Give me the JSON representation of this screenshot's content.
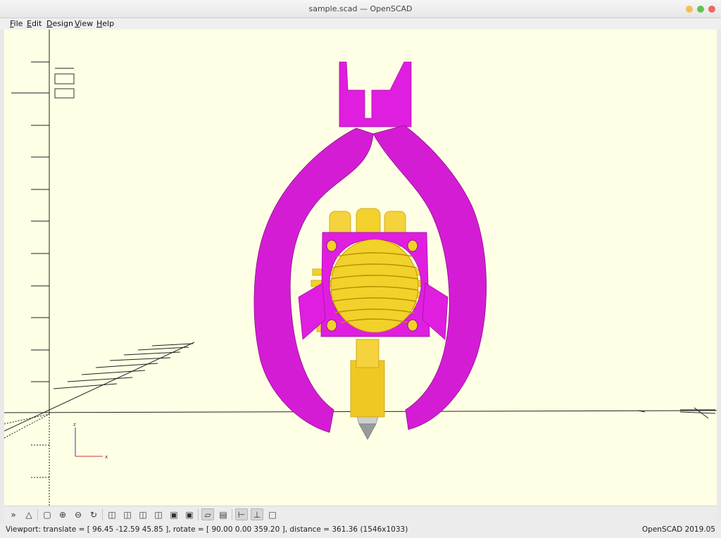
{
  "window": {
    "title": "sample.scad — OpenSCAD",
    "controls": [
      {
        "name": "minimize",
        "color": "#f5bf4f"
      },
      {
        "name": "maximize",
        "color": "#61c554"
      },
      {
        "name": "close",
        "color": "#ed6a5e"
      }
    ]
  },
  "menu": [
    {
      "label": "File",
      "mnemonic": "F",
      "rest": "ile"
    },
    {
      "label": "Edit",
      "mnemonic": "E",
      "rest": "dit"
    },
    {
      "label": "Design",
      "mnemonic": "D",
      "rest": "esign"
    },
    {
      "label": "View",
      "mnemonic": "V",
      "rest": "iew"
    },
    {
      "label": "Help",
      "mnemonic": "H",
      "rest": "elp"
    }
  ],
  "viewport": {
    "background": "#ffffe5",
    "colors": {
      "fan_duct": "#e01ee0",
      "hotend": "#f2d12a",
      "nozzle": "#b0b0b0"
    },
    "axis_labels": {
      "z": "z",
      "x": "x"
    }
  },
  "toolbar": [
    {
      "name": "preview",
      "icon": "preview-icon"
    },
    {
      "name": "render",
      "icon": "render-icon"
    },
    {
      "name": "view-all",
      "icon": "view-all-icon"
    },
    {
      "name": "zoom-in",
      "icon": "zoom-in-icon"
    },
    {
      "name": "zoom-out",
      "icon": "zoom-out-icon"
    },
    {
      "name": "reset-view",
      "icon": "reset-view-icon"
    },
    {
      "name": "view-right",
      "icon": "view-right-icon"
    },
    {
      "name": "view-top",
      "icon": "view-top-icon"
    },
    {
      "name": "view-bottom",
      "icon": "view-bottom-icon"
    },
    {
      "name": "view-left",
      "icon": "view-left-icon"
    },
    {
      "name": "view-front",
      "icon": "view-front-icon"
    },
    {
      "name": "view-back",
      "icon": "view-back-icon"
    },
    {
      "name": "perspective",
      "icon": "perspective-icon",
      "active": true
    },
    {
      "name": "orthogonal",
      "icon": "orthogonal-icon"
    },
    {
      "name": "show-axes",
      "icon": "axes-icon",
      "active": true
    },
    {
      "name": "show-scale-markers",
      "icon": "scale-markers-icon",
      "active": true
    },
    {
      "name": "show-edges",
      "icon": "edges-icon"
    }
  ],
  "status": {
    "viewport_text": "Viewport: translate = [ 96.45 -12.59 45.85 ], rotate = [ 90.00 0.00 359.20 ], distance = 361.36 (1546x1033)",
    "version": "OpenSCAD 2019.05"
  }
}
